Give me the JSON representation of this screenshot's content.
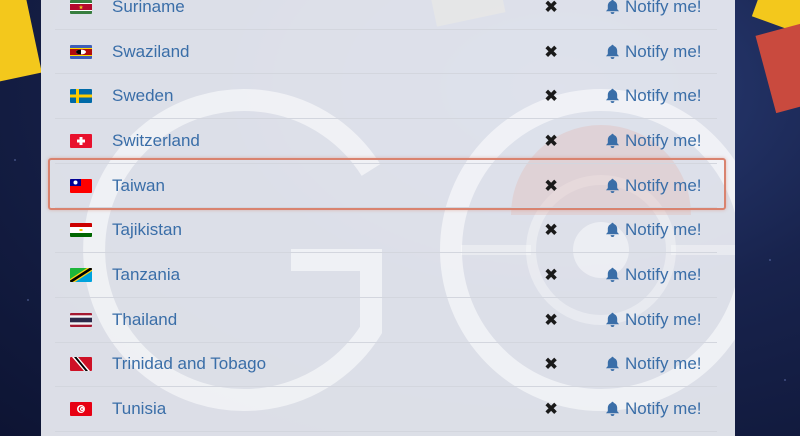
{
  "countries": [
    {
      "name": "Suriname",
      "flag": "suriname-flag-icon"
    },
    {
      "name": "Swaziland",
      "flag": "swaziland-flag-icon"
    },
    {
      "name": "Sweden",
      "flag": "sweden-flag-icon"
    },
    {
      "name": "Switzerland",
      "flag": "switzerland-flag-icon"
    },
    {
      "name": "Taiwan",
      "flag": "taiwan-flag-icon"
    },
    {
      "name": "Tajikistan",
      "flag": "tajikistan-flag-icon"
    },
    {
      "name": "Tanzania",
      "flag": "tanzania-flag-icon"
    },
    {
      "name": "Thailand",
      "flag": "thailand-flag-icon"
    },
    {
      "name": "Trinidad and Tobago",
      "flag": "trinidad-and-tobago-flag-icon"
    },
    {
      "name": "Tunisia",
      "flag": "tunisia-flag-icon"
    }
  ],
  "availability_symbol": "✖",
  "notify_label": "Notify me!",
  "highlighted_country": "Taiwan",
  "colors": {
    "link": "#3a6ea8",
    "highlight_border": "#d9836f",
    "panel": "#eceef4"
  }
}
